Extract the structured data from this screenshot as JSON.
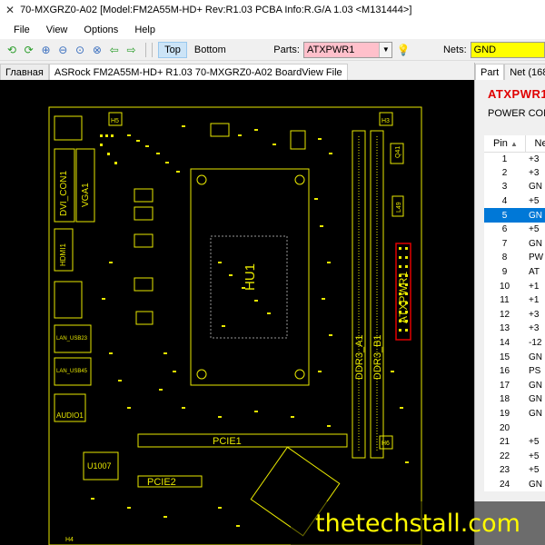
{
  "window": {
    "title": "70-MXGRZ0-A02 [Model:FM2A55M-HD+ Rev:R1.03 PCBA Info:R.G/A 1.03   <M131444>]"
  },
  "menu": [
    "File",
    "View",
    "Options",
    "Help"
  ],
  "toolbar": {
    "top_label": "Top",
    "bottom_label": "Bottom",
    "parts_label": "Parts:",
    "parts_value": "ATXPWR1",
    "nets_label": "Nets:",
    "nets_value": "GND"
  },
  "tabs": [
    "Главная",
    "ASRock FM2A55M-HD+ R1.03 70-MXGRZ0-A02 BoardView File"
  ],
  "board": {
    "labels": [
      "H5",
      "H3",
      "DVI_CON1",
      "VGA1",
      "HDMI1",
      "HU1",
      "DDR3_A1",
      "DDR3_B1",
      "ATXPWR1",
      "AUDIO1",
      "PCIE1",
      "PCIE2",
      "U1007",
      "H6",
      "H4",
      "LAN_USB23",
      "LAN_USB45",
      "Q41",
      "L49"
    ]
  },
  "side_panel": {
    "tabs": [
      "Part",
      "Net (168"
    ],
    "part_name": "ATXPWR1",
    "part_desc": "POWER CON",
    "col_pin": "Pin",
    "col_net": "Ne",
    "rows": [
      {
        "pin": "1",
        "net": "+3"
      },
      {
        "pin": "2",
        "net": "+3"
      },
      {
        "pin": "3",
        "net": "GN"
      },
      {
        "pin": "4",
        "net": "+5"
      },
      {
        "pin": "5",
        "net": "GN"
      },
      {
        "pin": "6",
        "net": "+5"
      },
      {
        "pin": "7",
        "net": "GN"
      },
      {
        "pin": "8",
        "net": "PW"
      },
      {
        "pin": "9",
        "net": "AT"
      },
      {
        "pin": "10",
        "net": "+1"
      },
      {
        "pin": "11",
        "net": "+1"
      },
      {
        "pin": "12",
        "net": "+3"
      },
      {
        "pin": "13",
        "net": "+3"
      },
      {
        "pin": "14",
        "net": "-12"
      },
      {
        "pin": "15",
        "net": "GN"
      },
      {
        "pin": "16",
        "net": "PS"
      },
      {
        "pin": "17",
        "net": "GN"
      },
      {
        "pin": "18",
        "net": "GN"
      },
      {
        "pin": "19",
        "net": "GN"
      },
      {
        "pin": "20",
        "net": ""
      },
      {
        "pin": "21",
        "net": "+5"
      },
      {
        "pin": "22",
        "net": "+5"
      },
      {
        "pin": "23",
        "net": "+5"
      },
      {
        "pin": "24",
        "net": "GN"
      }
    ],
    "selected_pin": "5"
  },
  "watermark": "thetechstall.com",
  "colors": {
    "board_bg": "#000000",
    "silkscreen": "#e8e800",
    "selected_part": "#e00000",
    "parts_field": "#ffc0cb",
    "nets_field": "#ffff00",
    "selection": "#0078d7",
    "watermark_text": "#fffa00"
  }
}
